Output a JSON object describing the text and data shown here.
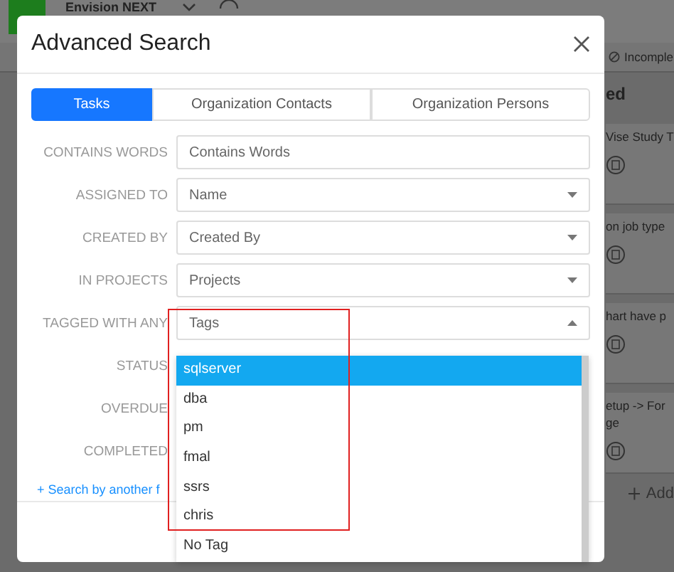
{
  "app": {
    "title": "Envision NEXT",
    "filter": "Incomple",
    "column_heading": "ed",
    "cards": [
      {
        "lines": [
          "Vise Study T"
        ]
      },
      {
        "lines": [
          "on job type"
        ]
      },
      {
        "lines": [
          "hart have p"
        ]
      },
      {
        "lines": [
          "etup -> For",
          "ge"
        ]
      }
    ],
    "add_label": "Add"
  },
  "dialog": {
    "title": "Advanced Search",
    "tabs": [
      {
        "label": "Tasks",
        "selected": true
      },
      {
        "label": "Organization Contacts",
        "selected": false
      },
      {
        "label": "Organization Persons",
        "selected": false
      }
    ],
    "fields": [
      {
        "label": "CONTAINS WORDS",
        "kind": "text",
        "placeholder": "Contains Words"
      },
      {
        "label": "ASSIGNED TO",
        "kind": "select",
        "placeholder": "Name"
      },
      {
        "label": "CREATED BY",
        "kind": "select",
        "placeholder": "Created By"
      },
      {
        "label": "IN PROJECTS",
        "kind": "select",
        "placeholder": "Projects"
      },
      {
        "label": "TAGGED WITH ANY",
        "kind": "select",
        "placeholder": "Tags",
        "expanded": true
      },
      {
        "label": "STATUS",
        "kind": "hidden"
      },
      {
        "label": "OVERDUE",
        "kind": "hidden"
      },
      {
        "label": "COMPLETED",
        "kind": "hidden"
      }
    ],
    "link": "+ Search by another f",
    "dropdown": [
      {
        "label": "sqlserver",
        "selected": true
      },
      {
        "label": "dba",
        "selected": false
      },
      {
        "label": "pm",
        "selected": false
      },
      {
        "label": "fmal",
        "selected": false
      },
      {
        "label": "ssrs",
        "selected": false
      },
      {
        "label": "chris",
        "selected": false
      },
      {
        "label": "No Tag",
        "selected": false
      }
    ]
  }
}
